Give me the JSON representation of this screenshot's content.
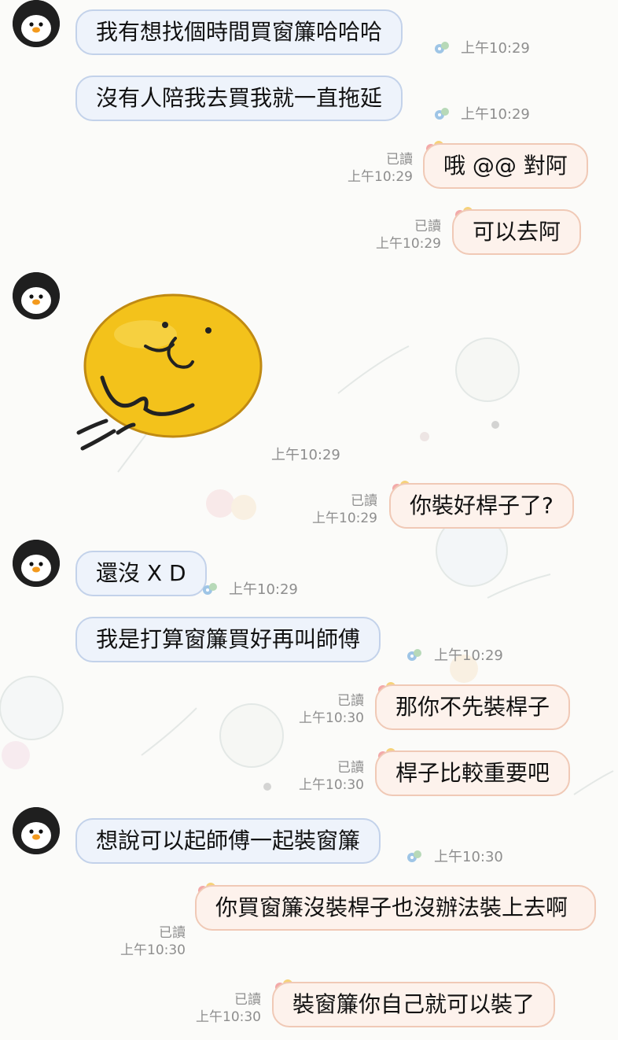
{
  "chat": {
    "messages": [
      {
        "side": "in",
        "text": "我有想找個時間買窗簾哈哈哈",
        "time": "上午10:29"
      },
      {
        "side": "in",
        "text": "沒有人陪我去買我就一直拖延",
        "time": "上午10:29"
      },
      {
        "side": "out",
        "text": "哦 @@ 對阿",
        "read": "已讀",
        "time": "上午10:29"
      },
      {
        "side": "out",
        "text": "可以去阿",
        "read": "已讀",
        "time": "上午10:29"
      },
      {
        "side": "in",
        "sticker": "smiling-yellow-blob-sticker",
        "time": "上午10:29"
      },
      {
        "side": "out",
        "text": "你裝好桿子了?",
        "read": "已讀",
        "time": "上午10:29"
      },
      {
        "side": "in",
        "text": "還沒 X D",
        "time": "上午10:29"
      },
      {
        "side": "in",
        "text": "我是打算窗簾買好再叫師傅",
        "time": "上午10:29"
      },
      {
        "side": "out",
        "text": "那你不先裝桿子",
        "read": "已讀",
        "time": "上午10:30"
      },
      {
        "side": "out",
        "text": "桿子比較重要吧",
        "read": "已讀",
        "time": "上午10:30"
      },
      {
        "side": "in",
        "text": "想說可以起師傅一起裝窗簾",
        "time": "上午10:30"
      },
      {
        "side": "out",
        "text": "你買窗簾沒裝桿子也沒辦法裝上去啊",
        "read": "已讀",
        "time": "上午10:30"
      },
      {
        "side": "out",
        "text": "裝窗簾你自己就可以裝了",
        "read": "已讀",
        "time": "上午10:30"
      }
    ]
  },
  "icons": {
    "avatar": "penguin-avatar",
    "bubble_decoration": "flower-decoration-icon"
  },
  "colors": {
    "incoming_bubble": "#eef3fb",
    "incoming_border": "#c3d2ea",
    "outgoing_bubble": "#fdf2ec",
    "outgoing_border": "#f0c9b6",
    "timestamp": "#8e8e8e"
  }
}
